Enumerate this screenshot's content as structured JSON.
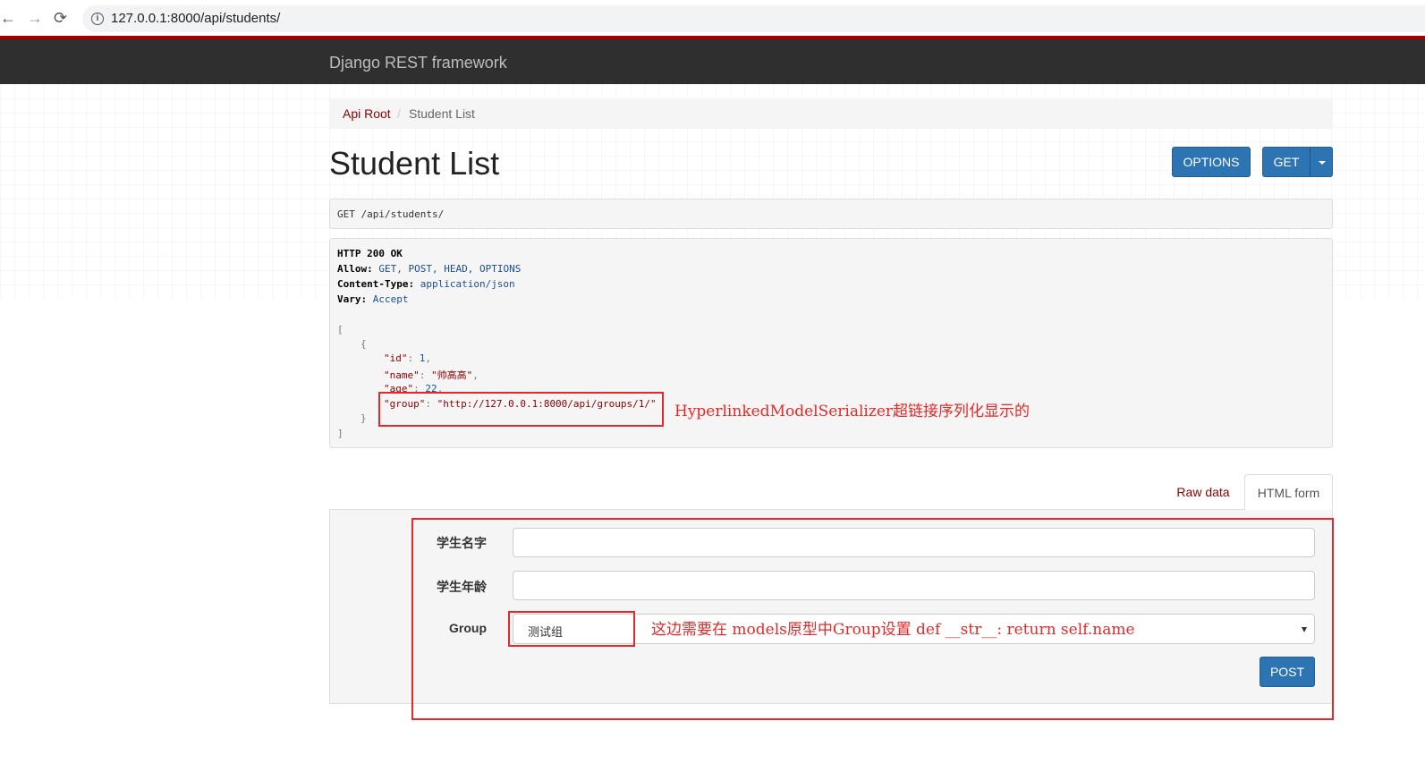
{
  "browser": {
    "back": "←",
    "forward": "→",
    "reload": "⟳",
    "url": "127.0.0.1:8000/api/students/"
  },
  "navbar": {
    "brand": "Django REST framework"
  },
  "breadcrumb": {
    "root": "Api Root",
    "separator": "/",
    "current": "Student List"
  },
  "page": {
    "title": "Student List"
  },
  "toolbar": {
    "options_label": "OPTIONS",
    "get_label": "GET"
  },
  "request": {
    "method": "GET",
    "path": "/api/students/"
  },
  "response": {
    "status": "HTTP 200 OK",
    "headers": [
      {
        "key": "Allow:",
        "value": "GET, POST, HEAD, OPTIONS"
      },
      {
        "key": "Content-Type:",
        "value": "application/json"
      },
      {
        "key": "Vary:",
        "value": "Accept"
      }
    ],
    "open_bracket": "[",
    "open_brace": "{",
    "close_brace": "}",
    "close_bracket": "]",
    "fields": {
      "id_key": "\"id\"",
      "id_value": "1",
      "name_key": "\"name\"",
      "name_value": "\"帅高高\"",
      "age_key": "\"age\"",
      "age_value": "22",
      "group_key": "\"group\"",
      "group_value": "\"http://127.0.0.1:8000/api/groups/1/\""
    }
  },
  "annotations": {
    "hyperlink_note": "HyperlinkedModelSerializer超链接序列化显示的",
    "group_note": "这边需要在 models原型中Group设置 def __str__: return self.name",
    "color": "#e62828"
  },
  "tabs": {
    "raw": "Raw data",
    "html": "HTML form"
  },
  "form": {
    "name_label": "学生名字",
    "age_label": "学生年龄",
    "group_label": "Group",
    "group_selected": "测试组",
    "post_label": "POST"
  },
  "colors": {
    "primary": "#2c74b2",
    "navbar": "#2f2f2f",
    "link": "#8b0000",
    "accent_line": "#a30000"
  }
}
